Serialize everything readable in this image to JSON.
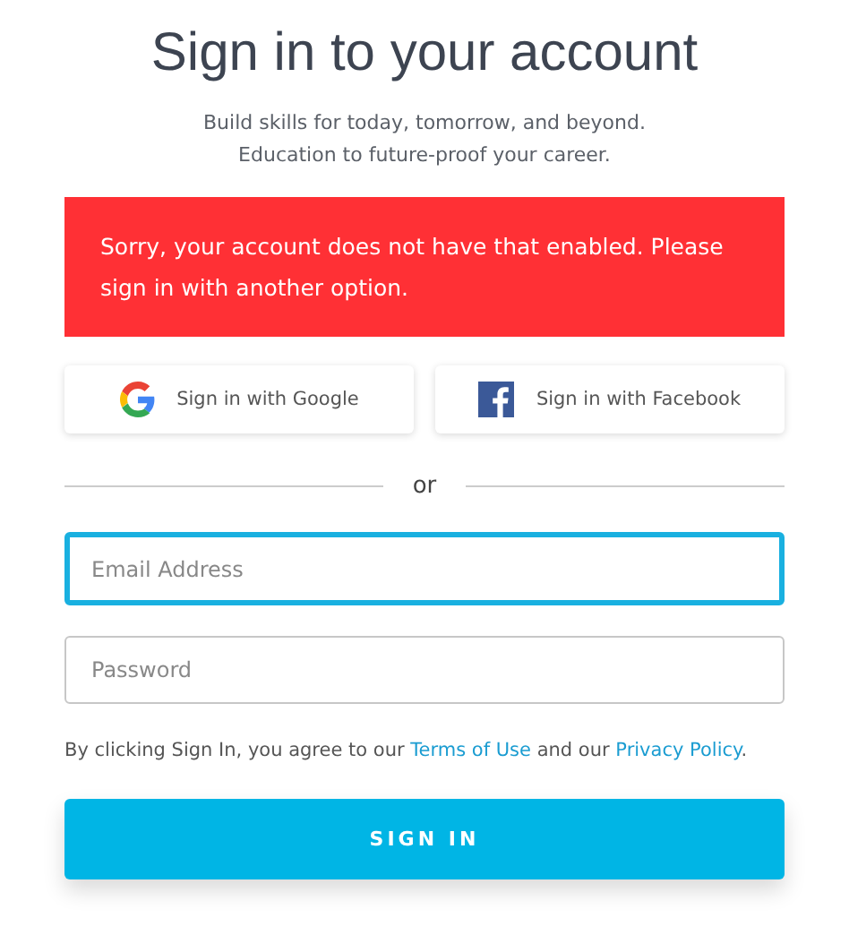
{
  "title": "Sign in to your account",
  "subtitle": [
    "Build skills for today, tomorrow, and beyond.",
    "Education to future-proof your career."
  ],
  "error": "Sorry, your account does not have that enabled. Please sign in with another option.",
  "social_buttons": [
    {
      "kind": "google",
      "label": "Sign in with Google"
    },
    {
      "kind": "facebook",
      "label": "Sign in with Facebook"
    }
  ],
  "divider": "or",
  "fields": [
    {
      "placeholder": "Email Address",
      "focused": true
    },
    {
      "placeholder": "Password",
      "focused": false
    }
  ],
  "agreement": [
    {
      "kind": "text",
      "text": "By clicking Sign In, you agree to our "
    },
    {
      "kind": "link",
      "text": "Terms of Use"
    },
    {
      "kind": "text",
      "text": " and our "
    },
    {
      "kind": "link",
      "text": "Privacy Policy"
    },
    {
      "kind": "text",
      "text": "."
    }
  ],
  "submit": "SIGN IN"
}
